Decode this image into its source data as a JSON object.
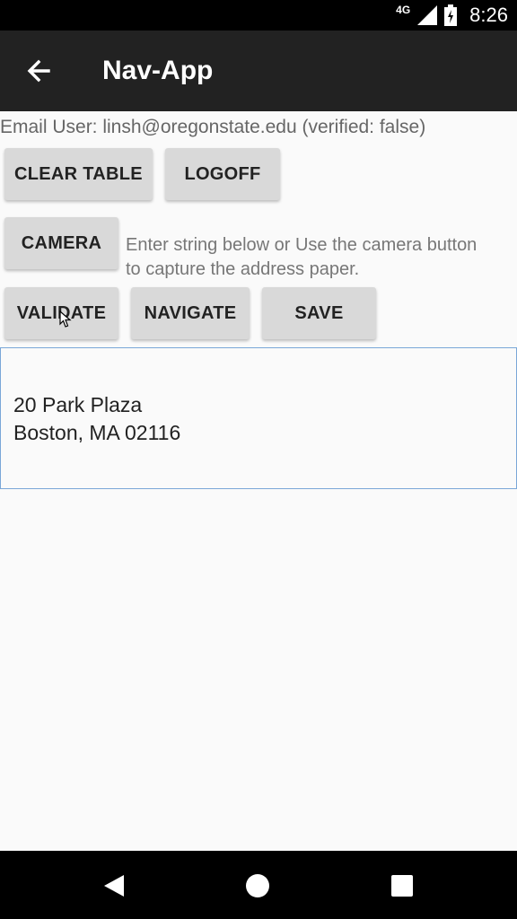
{
  "status_bar": {
    "network": "4G",
    "time": "8:26",
    "icons": [
      "signal-icon",
      "battery-icon"
    ]
  },
  "app_bar": {
    "title": "Nav-App",
    "back_icon": "arrow-left-icon"
  },
  "main": {
    "email_text": "Email User: linsh@oregonstate.edu (verified: false)",
    "buttons": {
      "clear_table": "CLEAR TABLE",
      "logoff": "LOGOFF",
      "camera": "CAMERA",
      "validate": "VALIDATE",
      "navigate": "NAVIGATE",
      "save": "SAVE"
    },
    "hint_line1": "Enter string below or Use the camera button",
    "hint_line2": "to capture the address paper.",
    "address_input": {
      "line1": "20 Park Plaza",
      "line2": "Boston, MA 02116"
    }
  },
  "nav_bar": {
    "icons": [
      "back-triangle-icon",
      "home-circle-icon",
      "recents-square-icon"
    ]
  },
  "colors": {
    "app_bar": "#222222",
    "content_bg": "#fafafa",
    "button_bg": "#d9d9d9",
    "input_border": "#7aa7d8"
  }
}
